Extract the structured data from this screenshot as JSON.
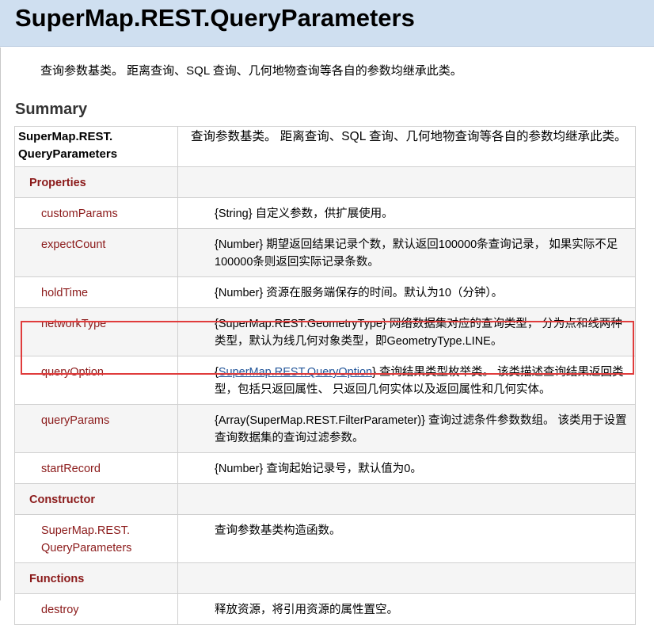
{
  "page": {
    "title": "SuperMap.REST.QueryParameters",
    "intro": "查询参数基类。 距离查询、SQL 查询、几何地物查询等各自的参数均继承此类。",
    "summary_heading": "Summary"
  },
  "table": {
    "header": {
      "name_line1": "SuperMap.REST.",
      "name_line2": "QueryParameters",
      "desc": "查询参数基类。 距离查询、SQL 查询、几何地物查询等各自的参数均继承此类。"
    },
    "sections": {
      "properties": "Properties",
      "constructor": "Constructor",
      "functions": "Functions"
    },
    "properties": [
      {
        "name": "customParams",
        "desc": "{String} 自定义参数，供扩展使用。"
      },
      {
        "name": "expectCount",
        "desc": "{Number} 期望返回结果记录个数，默认返回100000条查询记录， 如果实际不足100000条则返回实际记录条数。"
      },
      {
        "name": "holdTime",
        "desc": "{Number} 资源在服务端保存的时间。默认为10（分钟）。"
      },
      {
        "name": "networkType",
        "desc": "{SuperMap.REST.GeometryType} 网络数据集对应的查询类型， 分为点和线两种类型，默认为线几何对象类型，即GeometryType.LINE。"
      },
      {
        "name": "queryOption",
        "desc_pre": "{",
        "desc_link": "SuperMap.REST.QueryOption",
        "desc_post": "} 查询结果类型枚举类。 该类描述查询结果返回类型，包括只返回属性、 只返回几何实体以及返回属性和几何实体。"
      },
      {
        "name": "queryParams",
        "desc": "{Array(SuperMap.REST.FilterParameter)} 查询过滤条件参数数组。 该类用于设置查询数据集的查询过滤参数。"
      },
      {
        "name": "startRecord",
        "desc": "{Number} 查询起始记录号，默认值为0。"
      }
    ],
    "constructor": {
      "name_line1": "SuperMap.REST.",
      "name_line2": "QueryParameters",
      "desc": "查询参数基类构造函数。"
    },
    "functions": [
      {
        "name": "destroy",
        "desc": "释放资源，将引用资源的属性置空。"
      }
    ]
  },
  "highlight": {
    "color": "#e03c3c",
    "target": "queryOption"
  },
  "colors": {
    "title_bar": "#cfdff0",
    "member_name": "#8b1a1a",
    "link": "#225599",
    "row_bg": "#f5f5f5"
  }
}
